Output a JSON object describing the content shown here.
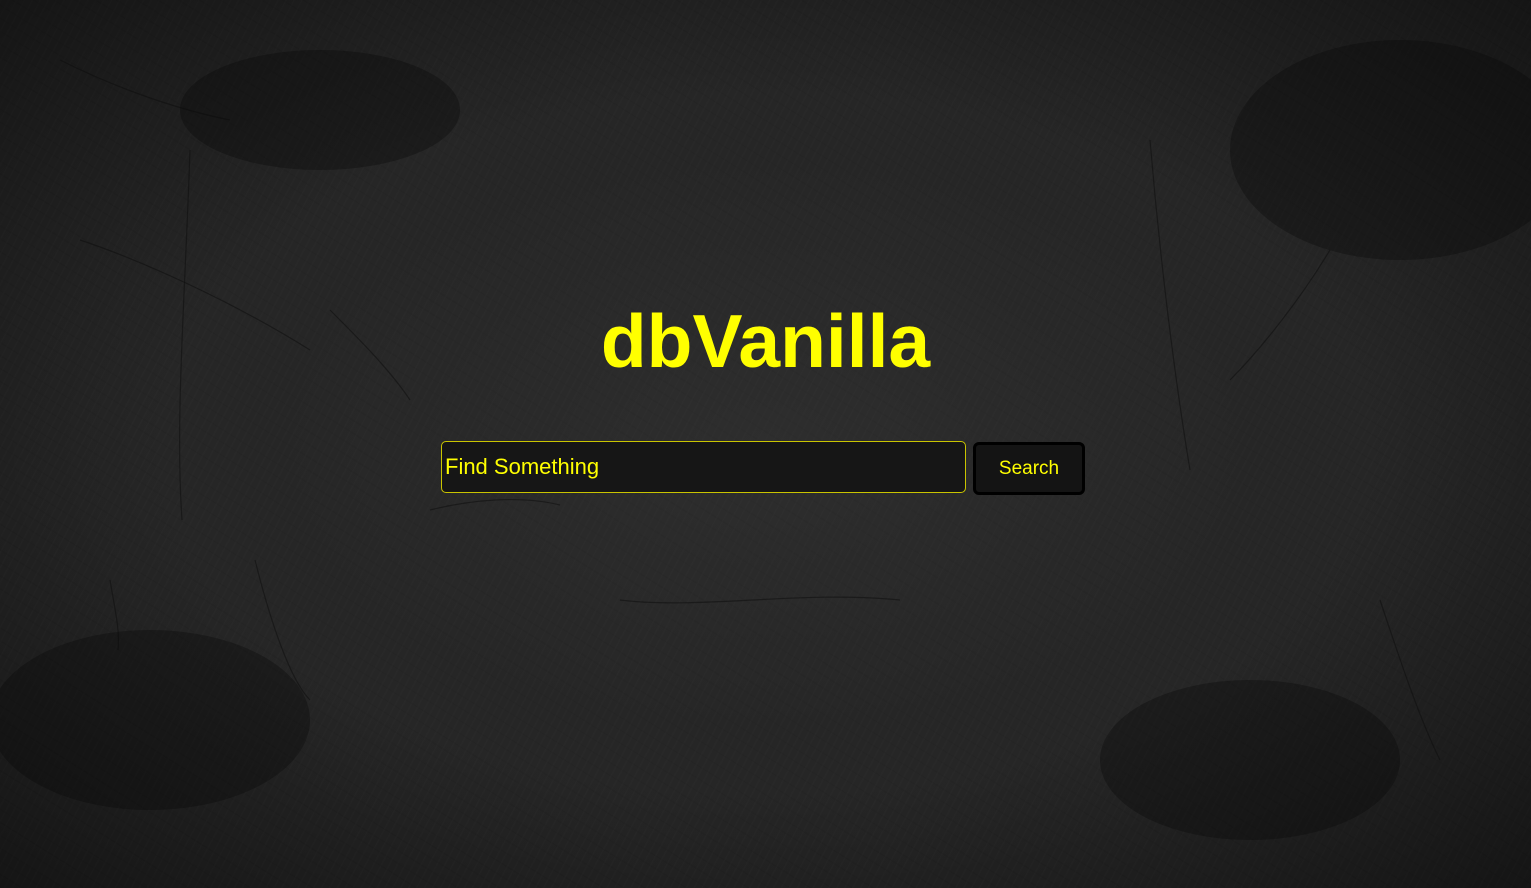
{
  "app": {
    "title": "dbVanilla"
  },
  "search": {
    "placeholder": "Find Something",
    "value": "",
    "button_label": "Search"
  },
  "colors": {
    "accent": "#ffff00",
    "background": "#262626",
    "input_border": "#c9c400"
  }
}
